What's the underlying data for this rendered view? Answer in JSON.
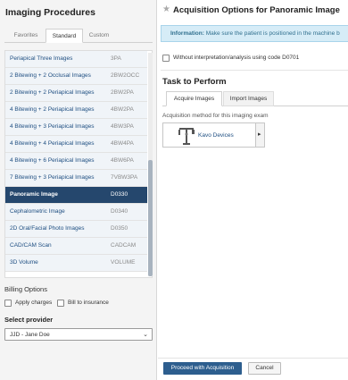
{
  "left": {
    "title": "Imaging Procedures",
    "tabs": [
      "Favorites",
      "Standard",
      "Custom"
    ],
    "procedures": [
      {
        "name": "Periapical Three Images",
        "code": "3PA"
      },
      {
        "name": "2 Bitewing + 2 Occlusal Images",
        "code": "2BW2OCC"
      },
      {
        "name": "2 Bitewing + 2 Periapical Images",
        "code": "2BW2PA"
      },
      {
        "name": "4 Bitewing + 2 Periapical Images",
        "code": "4BW2PA"
      },
      {
        "name": "4 Bitewing + 3 Periapical Images",
        "code": "4BW3PA"
      },
      {
        "name": "4 Bitewing + 4 Periapical Images",
        "code": "4BW4PA"
      },
      {
        "name": "4 Bitewing + 6 Periapical Images",
        "code": "4BW6PA"
      },
      {
        "name": "7 Bitewing + 3 Periapical Images",
        "code": "7VBW3PA"
      },
      {
        "name": "Panoramic Image",
        "code": "D0330"
      },
      {
        "name": "Cephalometric Image",
        "code": "D0340"
      },
      {
        "name": "2D Oral/Facial Photo Images",
        "code": "D0350"
      },
      {
        "name": "CAD/CAM Scan",
        "code": "CADCAM"
      },
      {
        "name": "3D Volume",
        "code": "VOLUME"
      }
    ],
    "billing_title": "Billing Options",
    "apply_charges": "Apply charges",
    "bill_insurance": "Bill to insurance",
    "provider_title": "Select provider",
    "provider_value": "JJD - Jane Doe"
  },
  "right": {
    "title": "Acquisition Options for Panoramic Image",
    "info_label": "Information:",
    "info_text": " Make sure the patient is positioned in the machine b",
    "without_label": "Without interpretation/analysis using code D0701",
    "task_title": "Task to Perform",
    "task_tabs": [
      "Acquire Images",
      "Import Images"
    ],
    "method_label": "Acquisition method for this imaging exam",
    "device_label": "Kavo Devices",
    "proceed_label": "Proceed with Acquisition",
    "cancel_label": "Cancel"
  },
  "colors": {
    "selected_row": "#25476d",
    "primary_button": "#2d5e8e",
    "info_bg": "#d6ecf7",
    "link_text": "#1f4f82"
  },
  "icons": [
    "star-icon",
    "xray-device-icon",
    "chevron-right-icon",
    "chevron-down-icon"
  ]
}
